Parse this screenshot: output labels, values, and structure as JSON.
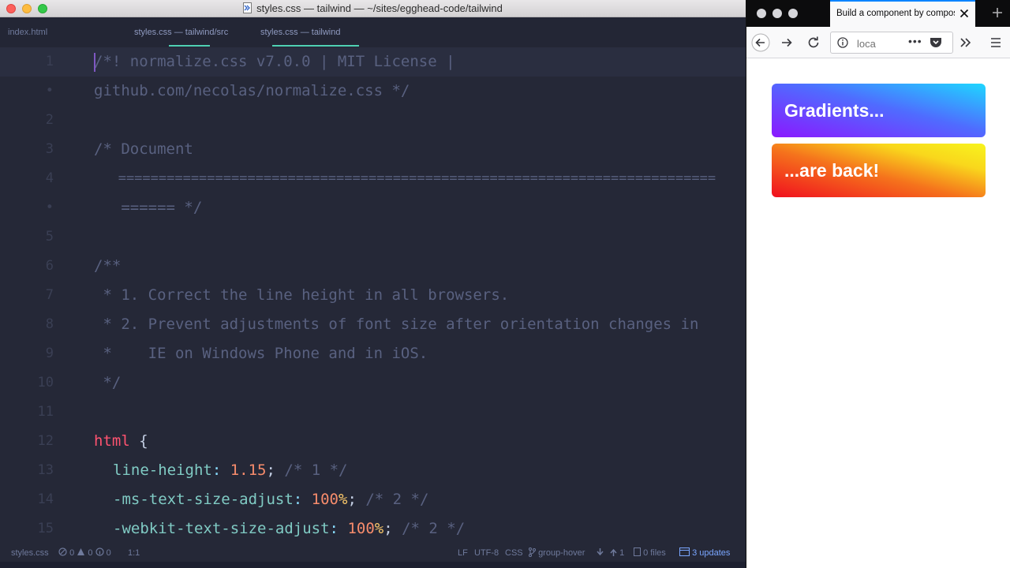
{
  "editor": {
    "window_title": "styles.css — tailwind — ~/sites/egghead-code/tailwind",
    "tabs": [
      {
        "label": "index.html"
      },
      {
        "label": "styles.css — tailwind/src"
      },
      {
        "label": "styles.css — tailwind"
      }
    ],
    "gutter": [
      "1",
      "•",
      "2",
      "3",
      "4",
      "•",
      "5",
      "6",
      "7",
      "8",
      "9",
      "10",
      "11",
      "12",
      "13",
      "14",
      "15"
    ],
    "code": {
      "l0": "/*! normalize.css v7.0.0 | MIT License |",
      "l1": "github.com/necolas/normalize.css */",
      "l3": "/* Document",
      "l4": "   ==========================================================================",
      "l5": "   ====== */",
      "l7": "/**",
      "l8": " * 1. Correct the line height in all browsers.",
      "l9": " * 2. Prevent adjustments of font size after orientation changes in",
      "l10": " *    IE on Windows Phone and in iOS.",
      "l11": " */",
      "l13_sel": "html",
      "l13_brace": " {",
      "l14_prop": "line-height",
      "l14_colon": ": ",
      "l14_val": "1.15",
      "l14_semi": ";",
      "l14_comment": " /* 1 */",
      "l15_prop": "-ms-text-size-adjust",
      "l15_colon": ": ",
      "l15_val": "100",
      "l15_unit": "%",
      "l15_semi": ";",
      "l15_comment": " /* 2 */",
      "l16_prop": "-webkit-text-size-adjust",
      "l16_colon": ": ",
      "l16_val": "100",
      "l16_unit": "%",
      "l16_semi": ";",
      "l16_comment": " /* 2 */"
    },
    "status": {
      "file": "styles.css",
      "errors": "0",
      "warnings": "0",
      "infos": "0",
      "cursor_pos": "1:1",
      "line_ending": "LF",
      "encoding": "UTF-8",
      "grammar": "CSS",
      "branch": "group-hover",
      "push_count": "1",
      "changed_files": "0 files",
      "updates": "3 updates"
    }
  },
  "browser": {
    "tab_title": "Build a component by composing",
    "url": "loca",
    "url_more": "•••",
    "cards": [
      {
        "text": "Gradients..."
      },
      {
        "text": "...are back!"
      }
    ]
  },
  "colors": {
    "editor_bg": "#252837",
    "accent_tab": "#4fd1b4",
    "selector": "#ff5370",
    "property": "#80cbc4",
    "number": "#f78c6c",
    "browser_tab_accent": "#0a84ff"
  }
}
